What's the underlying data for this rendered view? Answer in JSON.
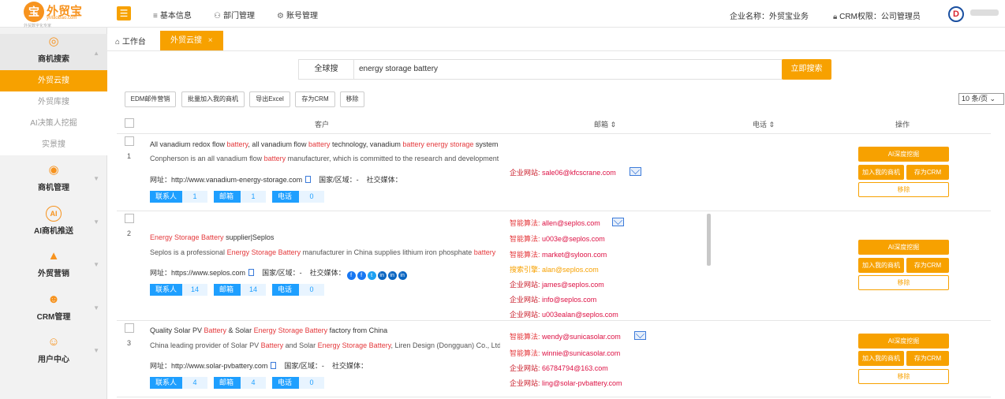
{
  "header": {
    "logo_mark": "宝",
    "logo_name": "外贸宝",
    "logo_sub": "yMaoBao.com",
    "logo_tag": "外贸数字化专家",
    "nav": [
      {
        "icon": "≡",
        "label": "基本信息"
      },
      {
        "icon": "⚇",
        "label": "部门管理"
      },
      {
        "icon": "⚙",
        "label": "账号管理"
      }
    ],
    "company_label": "企业名称：外贸宝业务",
    "crm_label": "CRM权限：",
    "crm_value": "公司管理员",
    "avatar_text": "D"
  },
  "sidebar": {
    "groups": [
      {
        "icon": "◎",
        "label": "商机搜索"
      },
      {
        "icon": "◉",
        "label": "商机管理"
      },
      {
        "icon": "AI",
        "label": "AI商机推送"
      },
      {
        "icon": "▲",
        "label": "外贸营销"
      },
      {
        "icon": "☻",
        "label": "CRM管理"
      },
      {
        "icon": "☺",
        "label": "用户中心"
      }
    ],
    "subs": [
      "外贸云搜",
      "外贸库搜",
      "AI决策人挖掘",
      "实景搜"
    ]
  },
  "tabs": {
    "home": "工作台",
    "active": "外贸云搜",
    "close": "×"
  },
  "search": {
    "scope": "全球搜",
    "query": "energy storage battery",
    "button": "立即搜索"
  },
  "toolbar": {
    "buttons": [
      "EDM邮件营销",
      "批量加入我的商机",
      "导出Excel",
      "存为CRM",
      "移除"
    ],
    "page_size": "10 条/页 ⌄"
  },
  "table": {
    "headers": {
      "customer": "客户",
      "email": "邮箱 ⇕",
      "phone": "电话 ⇕",
      "ops": "操作"
    },
    "website_label": "网址：",
    "country_label": "国家/区域：",
    "social_label": "社交媒体：",
    "tag_labels": {
      "contacts": "联系人",
      "email": "邮箱",
      "phone": "电话"
    },
    "action_labels": {
      "deep": "AI深度挖掘",
      "add": "加入我的商机",
      "crm": "存为CRM",
      "remove": "移除"
    },
    "rows": [
      {
        "num": "1",
        "title": [
          [
            "All vanadium redox flow ",
            0
          ],
          [
            "battery",
            1
          ],
          [
            ", all vanadium flow ",
            0
          ],
          [
            "battery",
            1
          ],
          [
            " technology, vanadium ",
            0
          ],
          [
            "battery energy storage",
            1
          ],
          [
            " system",
            0
          ]
        ],
        "desc": [
          [
            "Conpherson is an all vanadium flow ",
            0
          ],
          [
            "battery",
            1
          ],
          [
            " manufacturer, which is committed to the research and development",
            0
          ]
        ],
        "website": "http://www.vanadium-energy-storage.com",
        "country": "-",
        "social": "",
        "contacts": "1",
        "emails": "1",
        "phones": "0",
        "email_list": [
          {
            "src": "企业网站:",
            "addr": "sale06@kfcscrane.com",
            "type": "ent"
          }
        ]
      },
      {
        "num": "2",
        "title": [
          [
            "Energy Storage Battery",
            1
          ],
          [
            " supplier|Seplos",
            0
          ]
        ],
        "desc": [
          [
            "Seplos is a professional ",
            0
          ],
          [
            "Energy Storage Battery",
            1
          ],
          [
            " manufacturer in China supplies lithium iron phosphate ",
            0
          ],
          [
            "battery",
            1
          ]
        ],
        "website": "https://www.seplos.com",
        "country": "-",
        "social_icons": [
          {
            "name": "facebook-icon",
            "c": "#1877f2",
            "g": "f"
          },
          {
            "name": "facebook-icon",
            "c": "#1877f2",
            "g": "f"
          },
          {
            "name": "twitter-icon",
            "c": "#1da1f2",
            "g": "t"
          },
          {
            "name": "linkedin-icon",
            "c": "#0a66c2",
            "g": "in"
          },
          {
            "name": "linkedin-icon",
            "c": "#0a66c2",
            "g": "in"
          },
          {
            "name": "linkedin-icon",
            "c": "#0a66c2",
            "g": "in"
          }
        ],
        "contacts": "14",
        "emails": "14",
        "phones": "0",
        "email_list": [
          {
            "src": "智能算法:",
            "addr": "allen@seplos.com",
            "type": "ai"
          },
          {
            "src": "智能算法:",
            "addr": "u003e@seplos.com",
            "type": "ai"
          },
          {
            "src": "智能算法:",
            "addr": "market@syloon.com",
            "type": "ai"
          },
          {
            "src": "搜索引擎:",
            "addr": "alan@seplos.com",
            "type": "se"
          },
          {
            "src": "企业网站:",
            "addr": "james@seplos.com",
            "type": "ent"
          },
          {
            "src": "企业网站:",
            "addr": "info@seplos.com",
            "type": "ent"
          },
          {
            "src": "企业网站:",
            "addr": "u003ealan@seplos.com",
            "type": "ent"
          }
        ]
      },
      {
        "num": "3",
        "title": [
          [
            "Quality Solar PV ",
            0
          ],
          [
            "Battery",
            1
          ],
          [
            " & Solar ",
            0
          ],
          [
            "Energy Storage Battery",
            1
          ],
          [
            " factory from China",
            0
          ]
        ],
        "desc": [
          [
            "China leading provider of Solar PV ",
            0
          ],
          [
            "Battery",
            1
          ],
          [
            " and Solar ",
            0
          ],
          [
            "Energy Storage Battery",
            1
          ],
          [
            ", Liren Design (Dongguan) Co., Ltd.",
            0
          ]
        ],
        "website": "http://www.solar-pvbattery.com",
        "country": "-",
        "social": "",
        "contacts": "4",
        "emails": "4",
        "phones": "0",
        "email_list": [
          {
            "src": "智能算法:",
            "addr": "wendy@sunicasolar.com",
            "type": "ai"
          },
          {
            "src": "智能算法:",
            "addr": "winnie@sunicasolar.com",
            "type": "ai"
          },
          {
            "src": "企业网站:",
            "addr": "66784794@163.com",
            "type": "ent"
          },
          {
            "src": "企业网站:",
            "addr": "ling@solar-pvbattery.com",
            "type": "ent"
          }
        ]
      }
    ]
  }
}
